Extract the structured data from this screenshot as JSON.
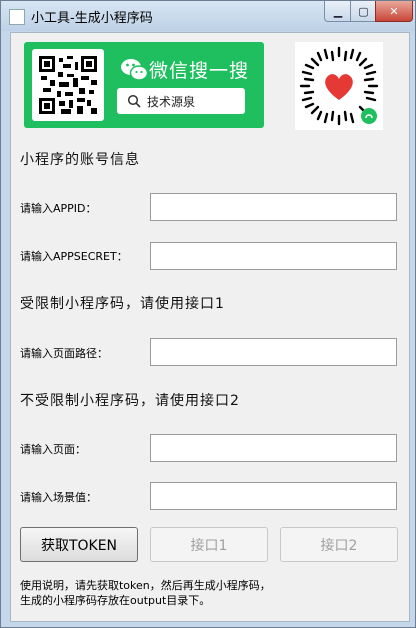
{
  "window": {
    "title": "小工具-生成小程序码",
    "min_label": "▁",
    "max_label": "▢",
    "close_label": "✕"
  },
  "banner": {
    "wechat_title": "微信搜一搜",
    "search_text": "技术源泉"
  },
  "account": {
    "section_title": "小程序的账号信息"
  },
  "fields": {
    "appid": {
      "label": "请输入APPID：",
      "value": ""
    },
    "appsecret": {
      "label": "请输入APPSECRET：",
      "value": ""
    },
    "page_path": {
      "label": "请输入页面路径：",
      "value": ""
    },
    "page": {
      "label": "请输入页面：",
      "value": ""
    },
    "scene": {
      "label": "请输入场景值：",
      "value": ""
    }
  },
  "limited": {
    "section_title": "受限制小程序码，请使用接口1"
  },
  "unlimited": {
    "section_title": "不受限制小程序码，请使用接口2"
  },
  "buttons": {
    "token": "获取TOKEN",
    "api1": "接口1",
    "api2": "接口2"
  },
  "notes": {
    "line1": "使用说明，请先获取token，然后再生成小程序码，",
    "line2": "生成的小程序码存放在output目录下。"
  },
  "colors": {
    "wechat_green": "#1fbf5f",
    "mini_heart": "#e53935"
  }
}
